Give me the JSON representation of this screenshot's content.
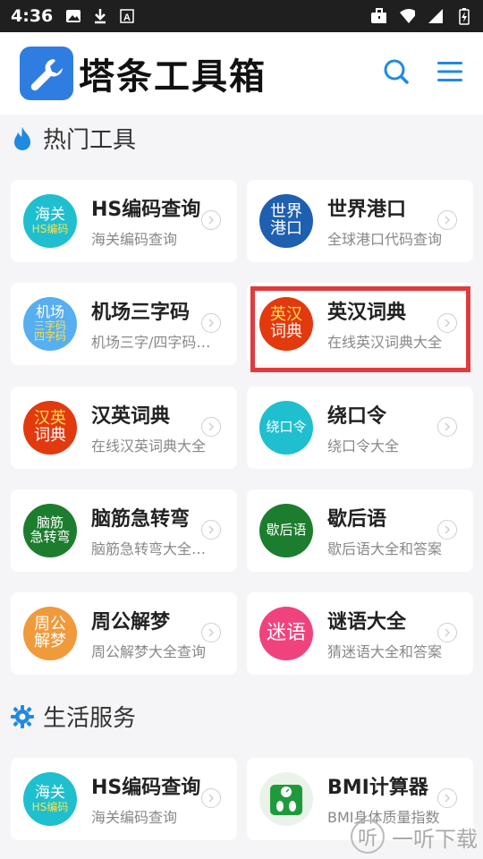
{
  "status": {
    "time": "4:36",
    "icons_left": [
      "image-icon",
      "download-icon",
      "a-box-icon"
    ],
    "icons_right": [
      "briefcase-icon",
      "wifi-icon",
      "signal-icon",
      "battery-icon"
    ]
  },
  "header": {
    "logo_text": "塔条工具箱",
    "actions": [
      "search-icon",
      "menu-icon"
    ]
  },
  "sections": {
    "hot": {
      "title": "热门工具"
    },
    "life": {
      "title": "生活服务"
    }
  },
  "cards": [
    {
      "badge": [
        "海关",
        "HS编码"
      ],
      "title": "HS编码查询",
      "subtitle": "海关编码查询",
      "color": "#1fbfd0"
    },
    {
      "badge": [
        "世界",
        "港口"
      ],
      "title": "世界港口",
      "subtitle": "全球港口代码查询",
      "color": "#1e5fb0"
    },
    {
      "badge": [
        "机场",
        "三字码",
        "四字码"
      ],
      "title": "机场三字码",
      "subtitle": "机场三字/四字码查询",
      "color": "#57aef0"
    },
    {
      "badge": [
        "英汉",
        "词典"
      ],
      "title": "英汉词典",
      "subtitle": "在线英汉词典大全",
      "color": "#e2390f"
    },
    {
      "badge": [
        "汉英",
        "词典"
      ],
      "title": "汉英词典",
      "subtitle": "在线汉英词典大全",
      "color": "#e2390f"
    },
    {
      "badge": [
        "绕口令"
      ],
      "title": "绕口令",
      "subtitle": "绕口令大全",
      "color": "#1fbfd0"
    },
    {
      "badge": [
        "脑筋",
        "急转弯"
      ],
      "title": "脑筋急转弯",
      "subtitle": "脑筋急转弯大全查询",
      "color": "#1d7d2e"
    },
    {
      "badge": [
        "歇后语"
      ],
      "title": "歇后语",
      "subtitle": "歇后语大全和答案",
      "color": "#1d7d2e"
    },
    {
      "badge": [
        "周公",
        "解梦"
      ],
      "title": "周公解梦",
      "subtitle": "周公解梦大全查询",
      "color": "#f09a3c"
    },
    {
      "badge": [
        "迷语"
      ],
      "title": "谜语大全",
      "subtitle": "猜迷语大全和答案",
      "color": "#f0437d"
    }
  ],
  "life_cards": [
    {
      "badge": [
        "海关",
        "HS编码"
      ],
      "title": "HS编码查询",
      "subtitle": "海关编码查询",
      "color": "#1fbfd0"
    },
    {
      "badge": [],
      "title": "BMI计算器",
      "subtitle": "BMI身体质量指数",
      "color": "#eaf3ea"
    }
  ],
  "watermark": {
    "text": "一听下载",
    "icon_text": "听"
  }
}
